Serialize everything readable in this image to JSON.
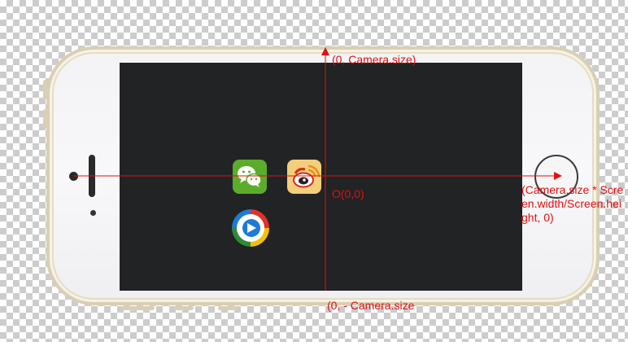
{
  "labels": {
    "top": "(0, Camera.size)",
    "bottom": "(0, - Camera.size",
    "origin": "O(0,0)",
    "right": "(Camera.size * Screen.width/Screen.height, 0)"
  },
  "icons": [
    "wechat-icon",
    "weibo-icon",
    "circle-app-icon"
  ],
  "colors": {
    "axis": "#e01010",
    "screen": "#222324",
    "phone_body": "#f3f3f5",
    "phone_frame": "#d9cfb4",
    "wechat": "#5cac2c",
    "weibo": "#f3cf7c"
  }
}
